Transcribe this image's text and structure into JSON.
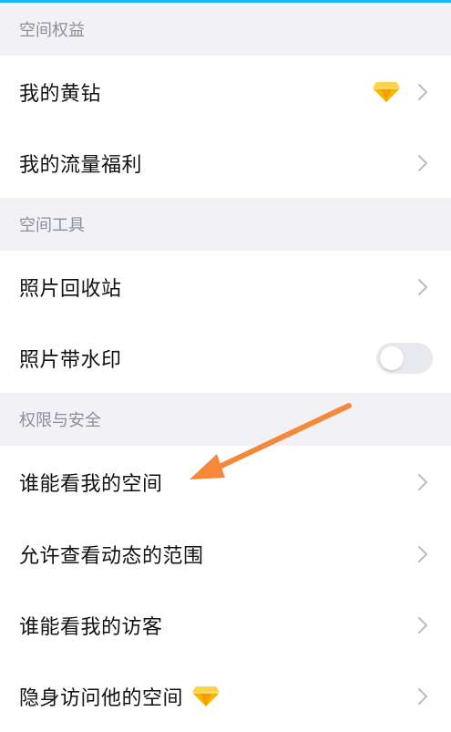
{
  "colors": {
    "accent_bar": "#1fb6f2",
    "section_bg": "#f2f2f6",
    "section_text": "#8a8f99",
    "chevron": "#b9bcc4",
    "diamond": "#f7b500",
    "arrow": "#f5883a",
    "toggle_off": "#e8e9ee"
  },
  "sections": [
    {
      "title": "空间权益",
      "items": [
        {
          "label": "我的黄钻",
          "icon": "yellow-diamond-icon"
        },
        {
          "label": "我的流量福利"
        }
      ]
    },
    {
      "title": "空间工具",
      "items": [
        {
          "label": "照片回收站"
        },
        {
          "label": "照片带水印",
          "toggle": false
        }
      ]
    },
    {
      "title": "权限与安全",
      "items": [
        {
          "label": "谁能看我的空间",
          "annotation": "orange-arrow-icon"
        },
        {
          "label": "允许查看动态的范围"
        },
        {
          "label": "谁能看我的访客"
        },
        {
          "label": "隐身访问他的空间",
          "icon": "yellow-diamond-icon"
        }
      ]
    }
  ]
}
